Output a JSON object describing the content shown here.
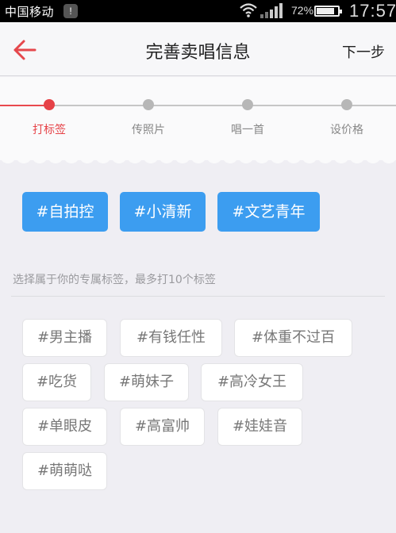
{
  "status_bar": {
    "carrier": "中国移动",
    "notification_badge": "!",
    "battery_percent": "72%",
    "time": "17:57"
  },
  "header": {
    "title": "完善卖唱信息",
    "next_label": "下一步",
    "accent_color": "#e5474c"
  },
  "steps": [
    {
      "label": "打标签",
      "active": true
    },
    {
      "label": "传照片",
      "active": false
    },
    {
      "label": "唱一首",
      "active": false
    },
    {
      "label": "设价格",
      "active": false
    }
  ],
  "selected_tags": [
    "#自拍控",
    "#小清新",
    "#文艺青年"
  ],
  "hint": "选择属于你的专属标签，最多打10个标签",
  "available_tags": [
    "#男主播",
    "#有钱任性",
    "#体重不过百",
    "#吃货",
    "#萌妹子",
    "#高冷女王",
    "#单眼皮",
    "#高富帅",
    "#娃娃音",
    "#萌萌哒"
  ],
  "colors": {
    "selected_tag_bg": "#3c9df0",
    "active_step": "#e64247",
    "page_bg": "#efeef3"
  }
}
